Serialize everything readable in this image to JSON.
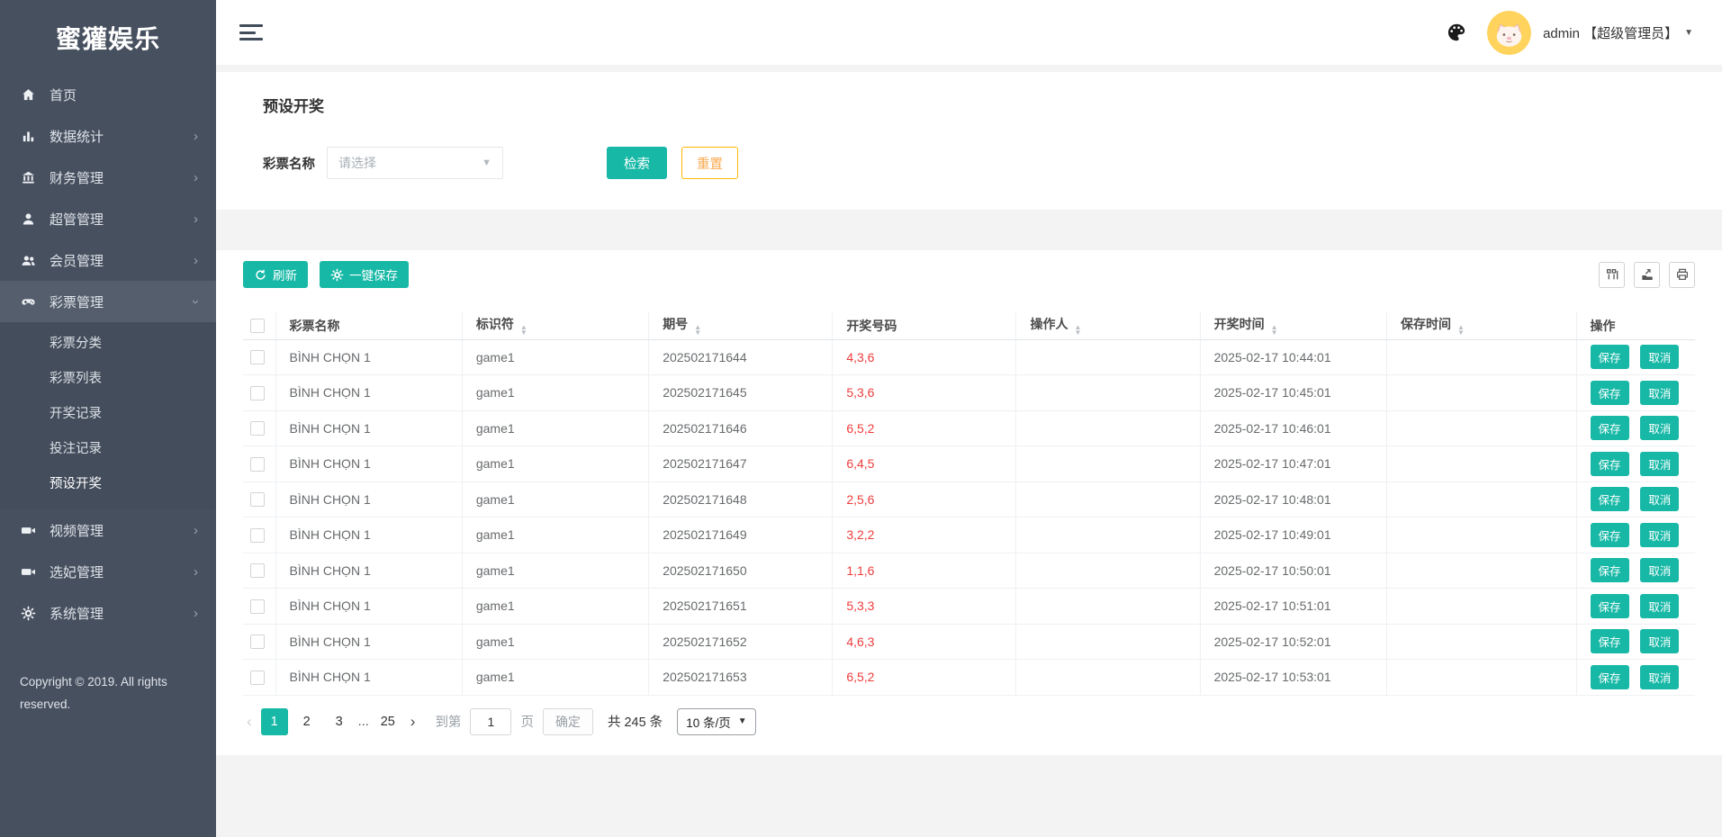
{
  "app": {
    "brand": "蜜獾娱乐",
    "copyright": "Copyright © 2019. All rights reserved."
  },
  "topbar": {
    "user_name": "admin 【超级管理员】"
  },
  "sidebar": {
    "items": [
      {
        "label": "首页",
        "icon": "home-icon"
      },
      {
        "label": "数据统计",
        "icon": "bar-chart-icon"
      },
      {
        "label": "财务管理",
        "icon": "bank-icon"
      },
      {
        "label": "超管管理",
        "icon": "user-icon"
      },
      {
        "label": "会员管理",
        "icon": "users-icon"
      },
      {
        "label": "彩票管理",
        "icon": "gamepad-icon"
      },
      {
        "label": "视频管理",
        "icon": "video-icon"
      },
      {
        "label": "选妃管理",
        "icon": "video-icon"
      },
      {
        "label": "系统管理",
        "icon": "gear-icon"
      }
    ],
    "submenu": [
      {
        "label": "彩票分类"
      },
      {
        "label": "彩票列表"
      },
      {
        "label": "开奖记录"
      },
      {
        "label": "投注记录"
      },
      {
        "label": "预设开奖"
      }
    ]
  },
  "page": {
    "title": "预设开奖"
  },
  "filter": {
    "label": "彩票名称",
    "placeholder": "请选择",
    "search_label": "检索",
    "reset_label": "重置"
  },
  "toolbar": {
    "refresh_label": "刷新",
    "save_all_label": "一键保存",
    "icons": [
      "columns-icon",
      "export-icon",
      "print-icon"
    ]
  },
  "table": {
    "headers": [
      {
        "label": "彩票名称",
        "sortable": false
      },
      {
        "label": "标识符",
        "sortable": true
      },
      {
        "label": "期号",
        "sortable": true
      },
      {
        "label": "开奖号码",
        "sortable": false
      },
      {
        "label": "操作人",
        "sortable": true
      },
      {
        "label": "开奖时间",
        "sortable": true
      },
      {
        "label": "保存时间",
        "sortable": true
      },
      {
        "label": "操作",
        "sortable": false
      }
    ],
    "rows": [
      {
        "name": "BÌNH CHỌN 1",
        "code": "game1",
        "issue": "202502171644",
        "numbers": "4,3,6",
        "operator": "",
        "draw_time": "2025-02-17 10:44:01",
        "save_time": ""
      },
      {
        "name": "BÌNH CHỌN 1",
        "code": "game1",
        "issue": "202502171645",
        "numbers": "5,3,6",
        "operator": "",
        "draw_time": "2025-02-17 10:45:01",
        "save_time": ""
      },
      {
        "name": "BÌNH CHỌN 1",
        "code": "game1",
        "issue": "202502171646",
        "numbers": "6,5,2",
        "operator": "",
        "draw_time": "2025-02-17 10:46:01",
        "save_time": ""
      },
      {
        "name": "BÌNH CHỌN 1",
        "code": "game1",
        "issue": "202502171647",
        "numbers": "6,4,5",
        "operator": "",
        "draw_time": "2025-02-17 10:47:01",
        "save_time": ""
      },
      {
        "name": "BÌNH CHỌN 1",
        "code": "game1",
        "issue": "202502171648",
        "numbers": "2,5,6",
        "operator": "",
        "draw_time": "2025-02-17 10:48:01",
        "save_time": ""
      },
      {
        "name": "BÌNH CHỌN 1",
        "code": "game1",
        "issue": "202502171649",
        "numbers": "3,2,2",
        "operator": "",
        "draw_time": "2025-02-17 10:49:01",
        "save_time": ""
      },
      {
        "name": "BÌNH CHỌN 1",
        "code": "game1",
        "issue": "202502171650",
        "numbers": "1,1,6",
        "operator": "",
        "draw_time": "2025-02-17 10:50:01",
        "save_time": ""
      },
      {
        "name": "BÌNH CHỌN 1",
        "code": "game1",
        "issue": "202502171651",
        "numbers": "5,3,3",
        "operator": "",
        "draw_time": "2025-02-17 10:51:01",
        "save_time": ""
      },
      {
        "name": "BÌNH CHỌN 1",
        "code": "game1",
        "issue": "202502171652",
        "numbers": "4,6,3",
        "operator": "",
        "draw_time": "2025-02-17 10:52:01",
        "save_time": ""
      },
      {
        "name": "BÌNH CHỌN 1",
        "code": "game1",
        "issue": "202502171653",
        "numbers": "6,5,2",
        "operator": "",
        "draw_time": "2025-02-17 10:53:01",
        "save_time": ""
      }
    ]
  },
  "row_actions": {
    "save": "保存",
    "cancel": "取消"
  },
  "pagination": {
    "pages": [
      "1",
      "2",
      "3",
      "...",
      "25"
    ],
    "active_page": "1",
    "goto_label": "到第",
    "goto_value": "1",
    "page_unit": "页",
    "confirm_label": "确定",
    "total_label": "共 245 条",
    "page_size_label": "10 条/页"
  },
  "colors": {
    "accent_teal": "#17b8a6",
    "warning_yellow": "#ffb800",
    "number_red": "#ef3c3c",
    "sidebar_bg": "#47505f"
  }
}
